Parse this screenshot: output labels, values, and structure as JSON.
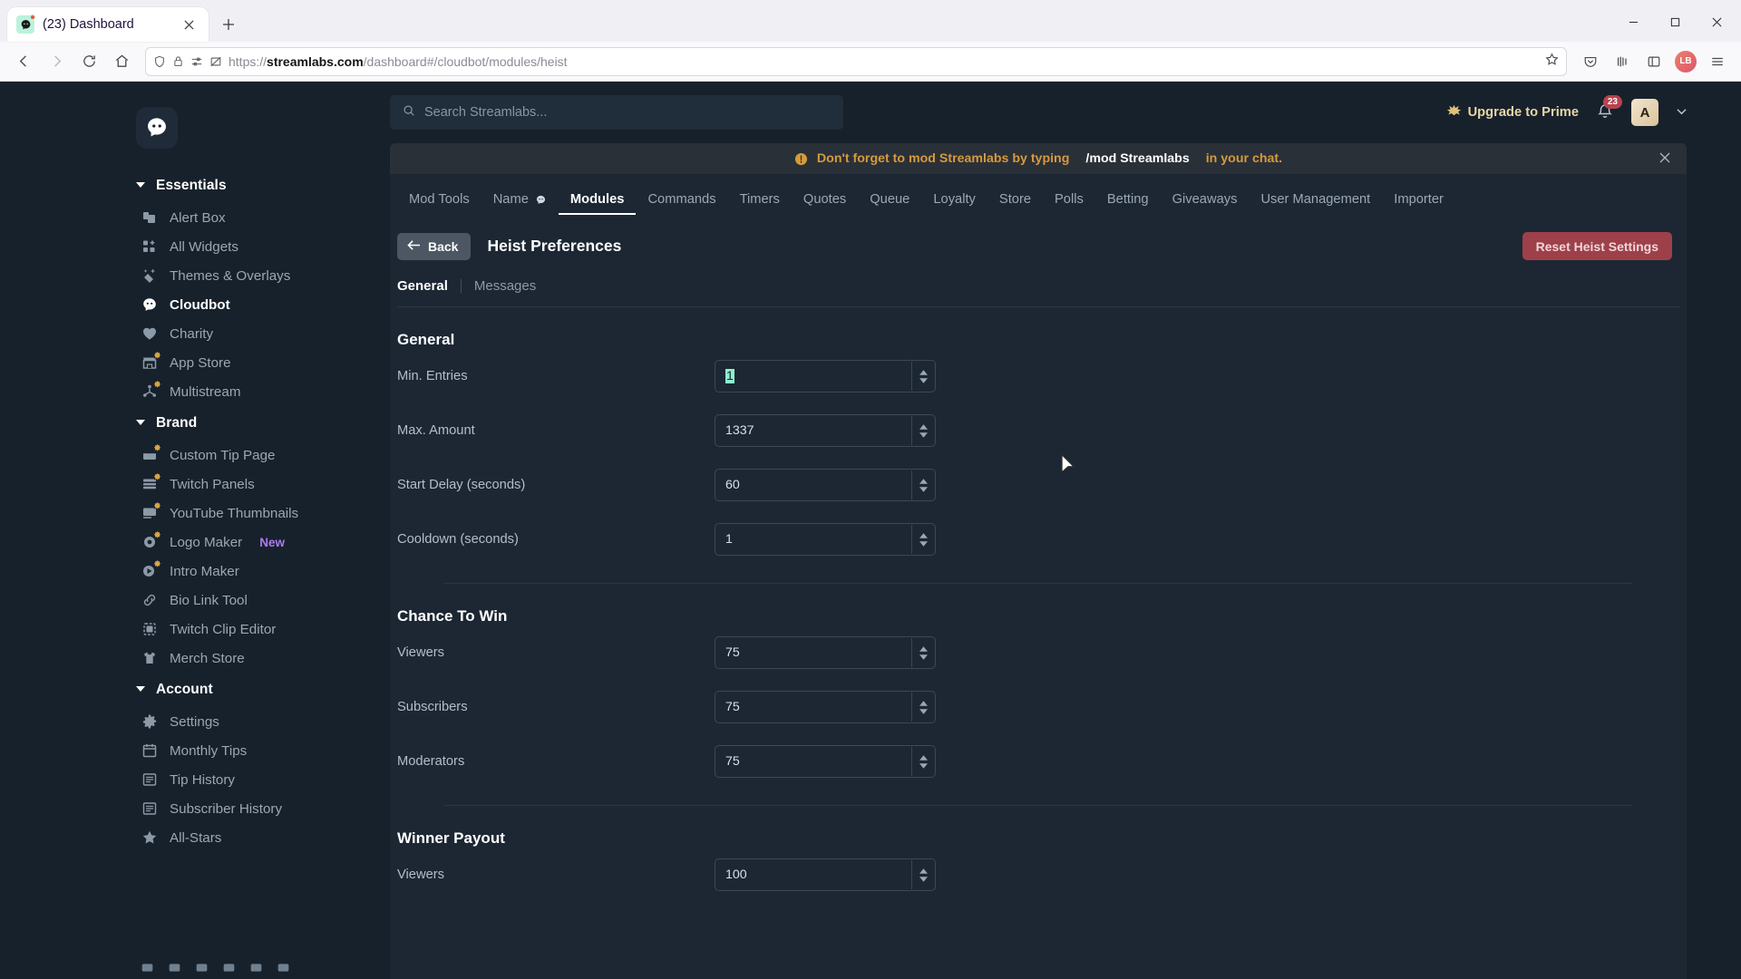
{
  "browser": {
    "tab": {
      "title": "(23) Dashboard",
      "favicon": "streamlabs-icon",
      "close": "✕"
    },
    "newtab_label": "+",
    "window_controls": {
      "minimize": "—",
      "maximize": "▢",
      "close": "✕"
    },
    "nav": {
      "back": "←",
      "forward": "→",
      "reload": "⟳",
      "home": "⌂"
    },
    "url": {
      "scheme": "https://",
      "domain": "streamlabs.com",
      "path": "/dashboard#/cloudbot/modules/heist"
    },
    "url_icons": [
      "shield-icon",
      "lock-icon",
      "permissions-icon",
      "no-tracking-icon"
    ],
    "bookmark_icon": "star-icon",
    "toolbar_right_icons": [
      "pocket-icon",
      "library-icon",
      "sidebar-icon",
      "account-avatar",
      "app-menu-icon"
    ],
    "account_initials": "LB"
  },
  "sidebar": {
    "logo": "streamlabs-logo",
    "groups": [
      {
        "title": "Essentials",
        "items": [
          {
            "label": "Alert Box",
            "icon": "alert-box-icon",
            "prime": false,
            "active": false
          },
          {
            "label": "All Widgets",
            "icon": "widgets-icon",
            "prime": false,
            "active": false
          },
          {
            "label": "Themes & Overlays",
            "icon": "themes-icon",
            "prime": false,
            "active": false
          },
          {
            "label": "Cloudbot",
            "icon": "cloudbot-icon",
            "prime": false,
            "active": true
          },
          {
            "label": "Charity",
            "icon": "heart-icon",
            "prime": false,
            "active": false
          },
          {
            "label": "App Store",
            "icon": "store-icon",
            "prime": true,
            "active": false
          },
          {
            "label": "Multistream",
            "icon": "multistream-icon",
            "prime": true,
            "active": false
          }
        ]
      },
      {
        "title": "Brand",
        "items": [
          {
            "label": "Custom Tip Page",
            "icon": "tip-page-icon",
            "prime": true,
            "active": false
          },
          {
            "label": "Twitch Panels",
            "icon": "panels-icon",
            "prime": true,
            "active": false
          },
          {
            "label": "YouTube Thumbnails",
            "icon": "thumbnail-icon",
            "prime": true,
            "active": false
          },
          {
            "label": "Logo Maker",
            "icon": "logo-maker-icon",
            "prime": true,
            "active": false,
            "tag": "New"
          },
          {
            "label": "Intro Maker",
            "icon": "intro-maker-icon",
            "prime": true,
            "active": false
          },
          {
            "label": "Bio Link Tool",
            "icon": "link-icon",
            "prime": false,
            "active": false
          },
          {
            "label": "Twitch Clip Editor",
            "icon": "clip-editor-icon",
            "prime": false,
            "active": false
          },
          {
            "label": "Merch Store",
            "icon": "shirt-icon",
            "prime": false,
            "active": false
          }
        ]
      },
      {
        "title": "Account",
        "items": [
          {
            "label": "Settings",
            "icon": "gear-icon",
            "prime": false,
            "active": false
          },
          {
            "label": "Monthly Tips",
            "icon": "calendar-icon",
            "prime": false,
            "active": false
          },
          {
            "label": "Tip History",
            "icon": "list-icon",
            "prime": false,
            "active": false
          },
          {
            "label": "Subscriber History",
            "icon": "list-icon",
            "prime": false,
            "active": false
          },
          {
            "label": "All-Stars",
            "icon": "star-icon",
            "prime": false,
            "active": false
          }
        ]
      }
    ],
    "social_icons": [
      "youtube-icon",
      "twitch-icon",
      "instagram-icon",
      "discord-icon",
      "twitter-icon",
      "facebook-icon"
    ]
  },
  "topbar": {
    "search_placeholder": "Search Streamlabs...",
    "search_icon": "search-icon",
    "upgrade_label": "Upgrade to Prime",
    "upgrade_icon": "prime-star-icon",
    "bell_icon": "bell-icon",
    "notification_count": "23",
    "avatar_initial": "A",
    "chevron_icon": "chevron-down-icon"
  },
  "notice": {
    "icon": "warning-icon",
    "text_before": "Don't forget to mod Streamlabs by typing",
    "command": "/mod Streamlabs",
    "text_after": "in your chat.",
    "close_icon": "close-icon"
  },
  "module_tabs": [
    {
      "label": "Mod Tools",
      "active": false
    },
    {
      "label": "Name",
      "active": false,
      "icon": "cloudbot-icon"
    },
    {
      "label": "Modules",
      "active": true
    },
    {
      "label": "Commands",
      "active": false
    },
    {
      "label": "Timers",
      "active": false
    },
    {
      "label": "Quotes",
      "active": false
    },
    {
      "label": "Queue",
      "active": false
    },
    {
      "label": "Loyalty",
      "active": false
    },
    {
      "label": "Store",
      "active": false
    },
    {
      "label": "Polls",
      "active": false
    },
    {
      "label": "Betting",
      "active": false
    },
    {
      "label": "Giveaways",
      "active": false
    },
    {
      "label": "User Management",
      "active": false
    },
    {
      "label": "Importer",
      "active": false
    }
  ],
  "page": {
    "back_label": "Back",
    "back_icon": "arrow-left-icon",
    "title": "Heist Preferences",
    "reset_label": "Reset Heist Settings"
  },
  "sub_tabs": [
    {
      "label": "General",
      "active": true
    },
    {
      "label": "Messages",
      "active": false
    }
  ],
  "sections": [
    {
      "title": "General",
      "fields": [
        {
          "label": "Min. Entries",
          "value": "1",
          "selected": true
        },
        {
          "label": "Max. Amount",
          "value": "1337",
          "selected": false
        },
        {
          "label": "Start Delay (seconds)",
          "value": "60",
          "selected": false
        },
        {
          "label": "Cooldown (seconds)",
          "value": "1",
          "selected": false
        }
      ]
    },
    {
      "title": "Chance To Win",
      "fields": [
        {
          "label": "Viewers",
          "value": "75",
          "selected": false
        },
        {
          "label": "Subscribers",
          "value": "75",
          "selected": false
        },
        {
          "label": "Moderators",
          "value": "75",
          "selected": false
        }
      ]
    },
    {
      "title": "Winner Payout",
      "fields": [
        {
          "label": "Viewers",
          "value": "100",
          "selected": false
        }
      ]
    }
  ],
  "colors": {
    "app_bg": "#17212b",
    "panel_bg": "#1c2733",
    "accent_prime": "#d9a441",
    "accent_new": "#a97cf0",
    "danger": "#9e4049",
    "selection": "#8bf0cf"
  }
}
